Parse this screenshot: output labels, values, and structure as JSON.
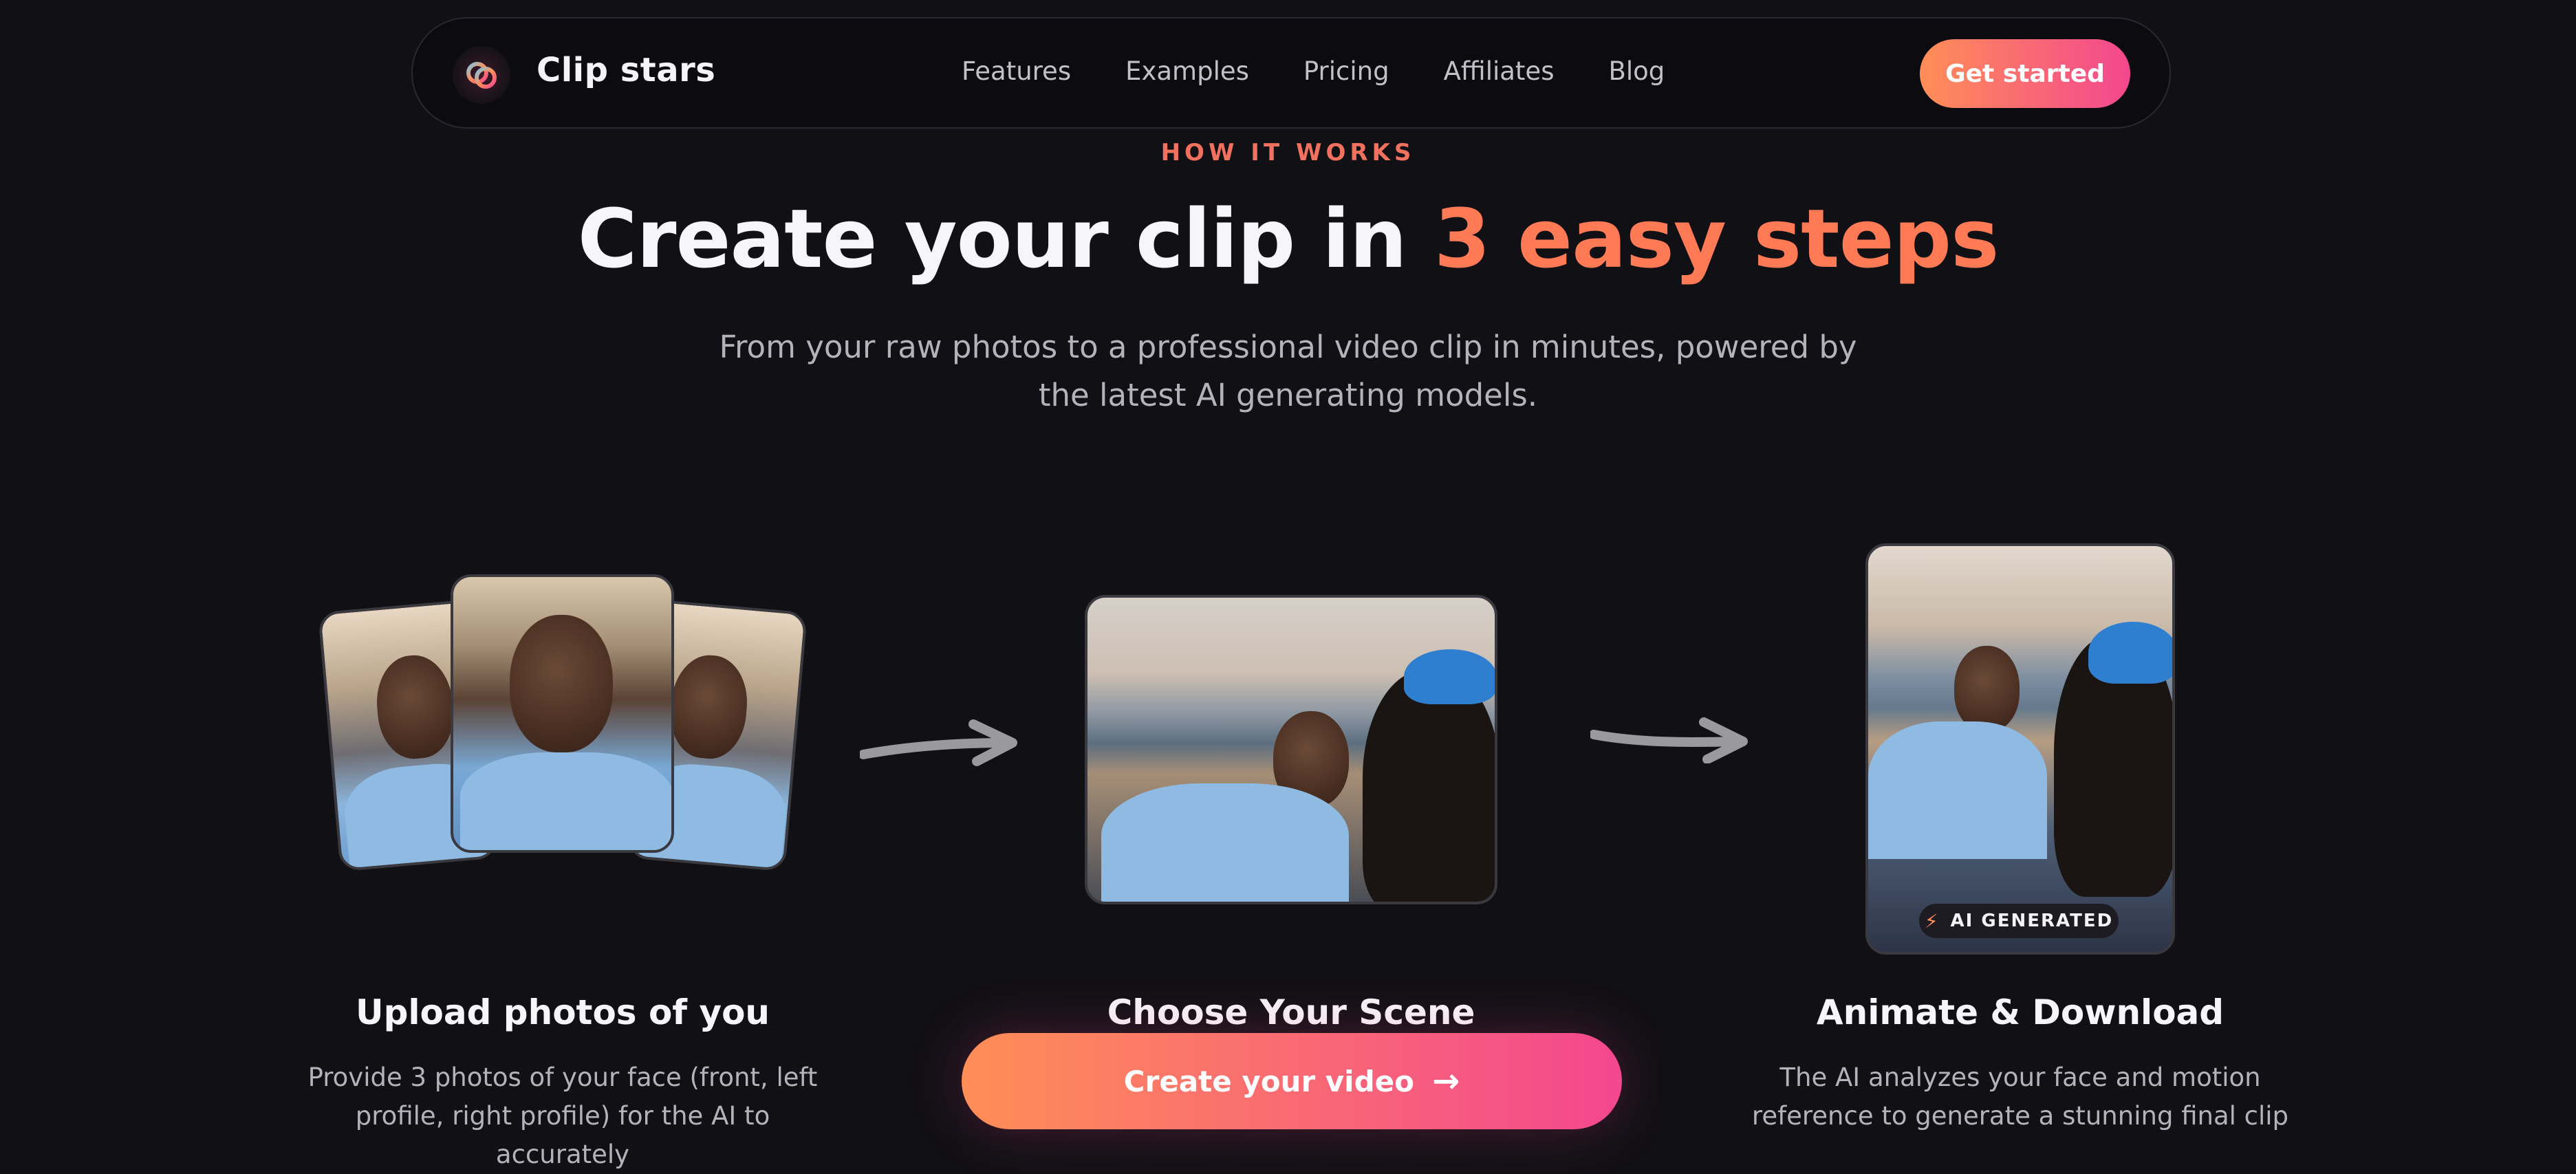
{
  "brand": {
    "name": "Clip stars",
    "logo_icon": "clip-stars-logo-icon"
  },
  "nav": {
    "links": [
      "Features",
      "Examples",
      "Pricing",
      "Affiliates",
      "Blog"
    ],
    "cta_label": "Get started"
  },
  "hero": {
    "eyebrow": "HOW IT WORKS",
    "headline_main": "Create your clip in ",
    "headline_accent": "3 easy steps",
    "subtitle": "From your raw photos to a professional video clip in minutes, powered by the latest AI generating models."
  },
  "steps": [
    {
      "title": "Upload photos of you",
      "description": "Provide 3 photos of your face (front, left profile, right profile) for the AI to accurately"
    },
    {
      "title": "Choose Your Scene",
      "description": ""
    },
    {
      "title": "Animate & Download",
      "description": "The AI analyzes your face and motion reference to generate a stunning final clip"
    }
  ],
  "ai_badge": "AI GENERATED",
  "primary_cta": {
    "label": "Create your video",
    "icon": "arrow-right-icon"
  },
  "colors": {
    "accent_start": "#ff8e57",
    "accent_end": "#f3478f",
    "background": "#111015"
  }
}
